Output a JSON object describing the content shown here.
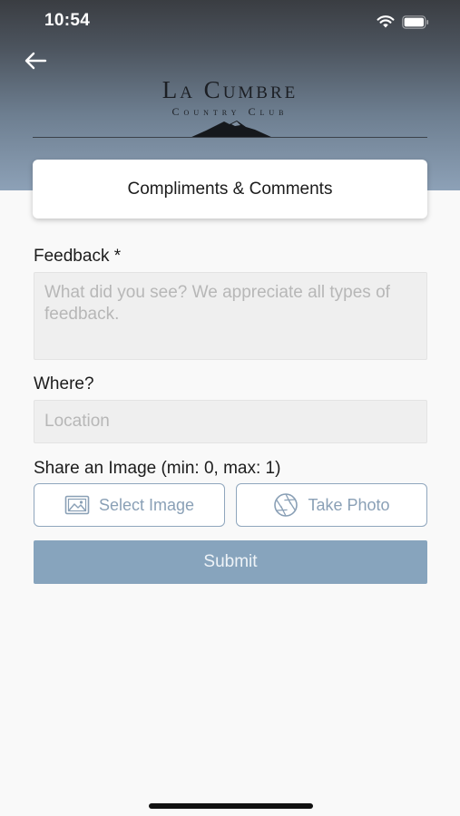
{
  "status_bar": {
    "time": "10:54"
  },
  "header": {
    "logo_title": "La Cumbre",
    "logo_subtitle": "Country Club",
    "card_title": "Compliments & Comments"
  },
  "form": {
    "feedback_label": "Feedback *",
    "feedback_placeholder": "What did you see? We appreciate all types of feedback.",
    "where_label": "Where?",
    "location_placeholder": "Location",
    "image_label": "Share an Image (min: 0, max: 1)",
    "select_image_label": "Select Image",
    "take_photo_label": "Take Photo",
    "submit_label": "Submit"
  },
  "colors": {
    "accent": "#87a4bd",
    "outline": "#8fa6bd",
    "background": "#f9f9f9"
  },
  "icons": [
    "back-arrow-icon",
    "wifi-icon",
    "battery-icon",
    "image-icon",
    "camera-aperture-icon"
  ]
}
